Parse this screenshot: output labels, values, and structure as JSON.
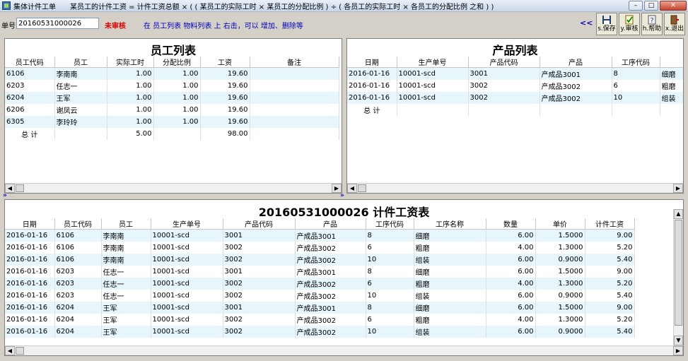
{
  "window": {
    "title": "集体计件工单",
    "formula": "某员工的计件工资 = 计件工资总额 × ( ( 某员工的实际工时 × 某员工的分配比例 ) ÷ ( 各员工的实际工时 × 各员工的分配比例 之和 ) )"
  },
  "toolbar": {
    "no_label": "单号",
    "no_value": "20160531000026",
    "status": "未审核",
    "hint": "在 员工列表 物料列表 上 右击，可以 增加、删除等",
    "collapse": "<<",
    "buttons": [
      {
        "label": "s.保存",
        "icon": "save-icon"
      },
      {
        "label": "y.审核",
        "icon": "audit-icon"
      },
      {
        "label": "h.帮助",
        "icon": "help-icon"
      },
      {
        "label": "x.退出",
        "icon": "exit-icon"
      }
    ]
  },
  "employees": {
    "title": "员工列表",
    "columns": [
      "员工代码",
      "员工",
      "实际工时",
      "分配比例",
      "工资",
      "备注"
    ],
    "rows": [
      [
        "6106",
        "李南南",
        "1.00",
        "1.00",
        "19.60",
        ""
      ],
      [
        "6203",
        "任志一",
        "1.00",
        "1.00",
        "19.60",
        ""
      ],
      [
        "6204",
        "王军",
        "1.00",
        "1.00",
        "19.60",
        ""
      ],
      [
        "6206",
        "谢凤云",
        "1.00",
        "1.00",
        "19.60",
        ""
      ],
      [
        "6305",
        "李玲玲",
        "1.00",
        "1.00",
        "19.60",
        ""
      ]
    ],
    "total": {
      "label": "总  计",
      "hours": "5.00",
      "wage": "98.00"
    }
  },
  "products": {
    "title": "产品列表",
    "columns": [
      "日期",
      "生产单号",
      "产品代码",
      "产品",
      "工序代码",
      ""
    ],
    "rows": [
      [
        "2016-01-16",
        "10001-scd",
        "3001",
        "产成品3001",
        "8",
        "细磨"
      ],
      [
        "2016-01-16",
        "10001-scd",
        "3002",
        "产成品3002",
        "6",
        "粗磨"
      ],
      [
        "2016-01-16",
        "10001-scd",
        "3002",
        "产成品3002",
        "10",
        "组装"
      ]
    ],
    "total": {
      "label": "总  计"
    }
  },
  "wages": {
    "title": "20160531000026  计件工资表",
    "columns": [
      "日期",
      "员工代码",
      "员工",
      "生产单号",
      "产品代码",
      "产品",
      "工序代码",
      "工序名称",
      "数量",
      "单价",
      "计件工资"
    ],
    "rows": [
      [
        "2016-01-16",
        "6106",
        "李南南",
        "10001-scd",
        "3001",
        "产成品3001",
        "8",
        "细磨",
        "6.00",
        "1.5000",
        "9.00"
      ],
      [
        "2016-01-16",
        "6106",
        "李南南",
        "10001-scd",
        "3002",
        "产成品3002",
        "6",
        "粗磨",
        "4.00",
        "1.3000",
        "5.20"
      ],
      [
        "2016-01-16",
        "6106",
        "李南南",
        "10001-scd",
        "3002",
        "产成品3002",
        "10",
        "组装",
        "6.00",
        "0.9000",
        "5.40"
      ],
      [
        "2016-01-16",
        "6203",
        "任志一",
        "10001-scd",
        "3001",
        "产成品3001",
        "8",
        "细磨",
        "6.00",
        "1.5000",
        "9.00"
      ],
      [
        "2016-01-16",
        "6203",
        "任志一",
        "10001-scd",
        "3002",
        "产成品3002",
        "6",
        "粗磨",
        "4.00",
        "1.3000",
        "5.20"
      ],
      [
        "2016-01-16",
        "6203",
        "任志一",
        "10001-scd",
        "3002",
        "产成品3002",
        "10",
        "组装",
        "6.00",
        "0.9000",
        "5.40"
      ],
      [
        "2016-01-16",
        "6204",
        "王军",
        "10001-scd",
        "3001",
        "产成品3001",
        "8",
        "细磨",
        "6.00",
        "1.5000",
        "9.00"
      ],
      [
        "2016-01-16",
        "6204",
        "王军",
        "10001-scd",
        "3002",
        "产成品3002",
        "6",
        "粗磨",
        "4.00",
        "1.3000",
        "5.20"
      ],
      [
        "2016-01-16",
        "6204",
        "王军",
        "10001-scd",
        "3002",
        "产成品3002",
        "10",
        "组装",
        "6.00",
        "0.9000",
        "5.40"
      ]
    ]
  },
  "splitters": {
    "left": "»",
    "right": "»"
  }
}
